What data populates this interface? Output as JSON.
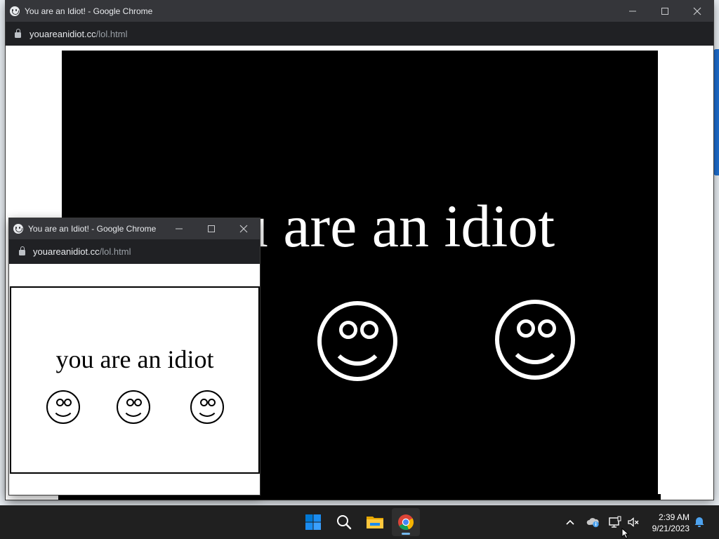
{
  "main_window": {
    "title": "You are an Idiot! - Google Chrome",
    "url_host": "youareanidiot.cc",
    "url_path": "/lol.html",
    "headline": "you are an idiot",
    "page_background": "#000000",
    "text_color": "#ffffff"
  },
  "popup_window": {
    "title": "You are an Idiot! - Google Chrome",
    "url_host": "youareanidiot.cc",
    "url_path": "/lol.html",
    "headline": "you are an idiot",
    "page_background": "#ffffff",
    "text_color": "#000000"
  },
  "taskbar": {
    "apps": [
      "windows-start",
      "search",
      "file-explorer",
      "google-chrome"
    ],
    "active_app": "google-chrome",
    "clock_time": "2:39 AM",
    "clock_date": "9/21/2023"
  },
  "colors": {
    "titlebar": "#35363a",
    "addressbar": "#202124",
    "taskbar": "#202020",
    "windows_blue": "#0078d4"
  }
}
